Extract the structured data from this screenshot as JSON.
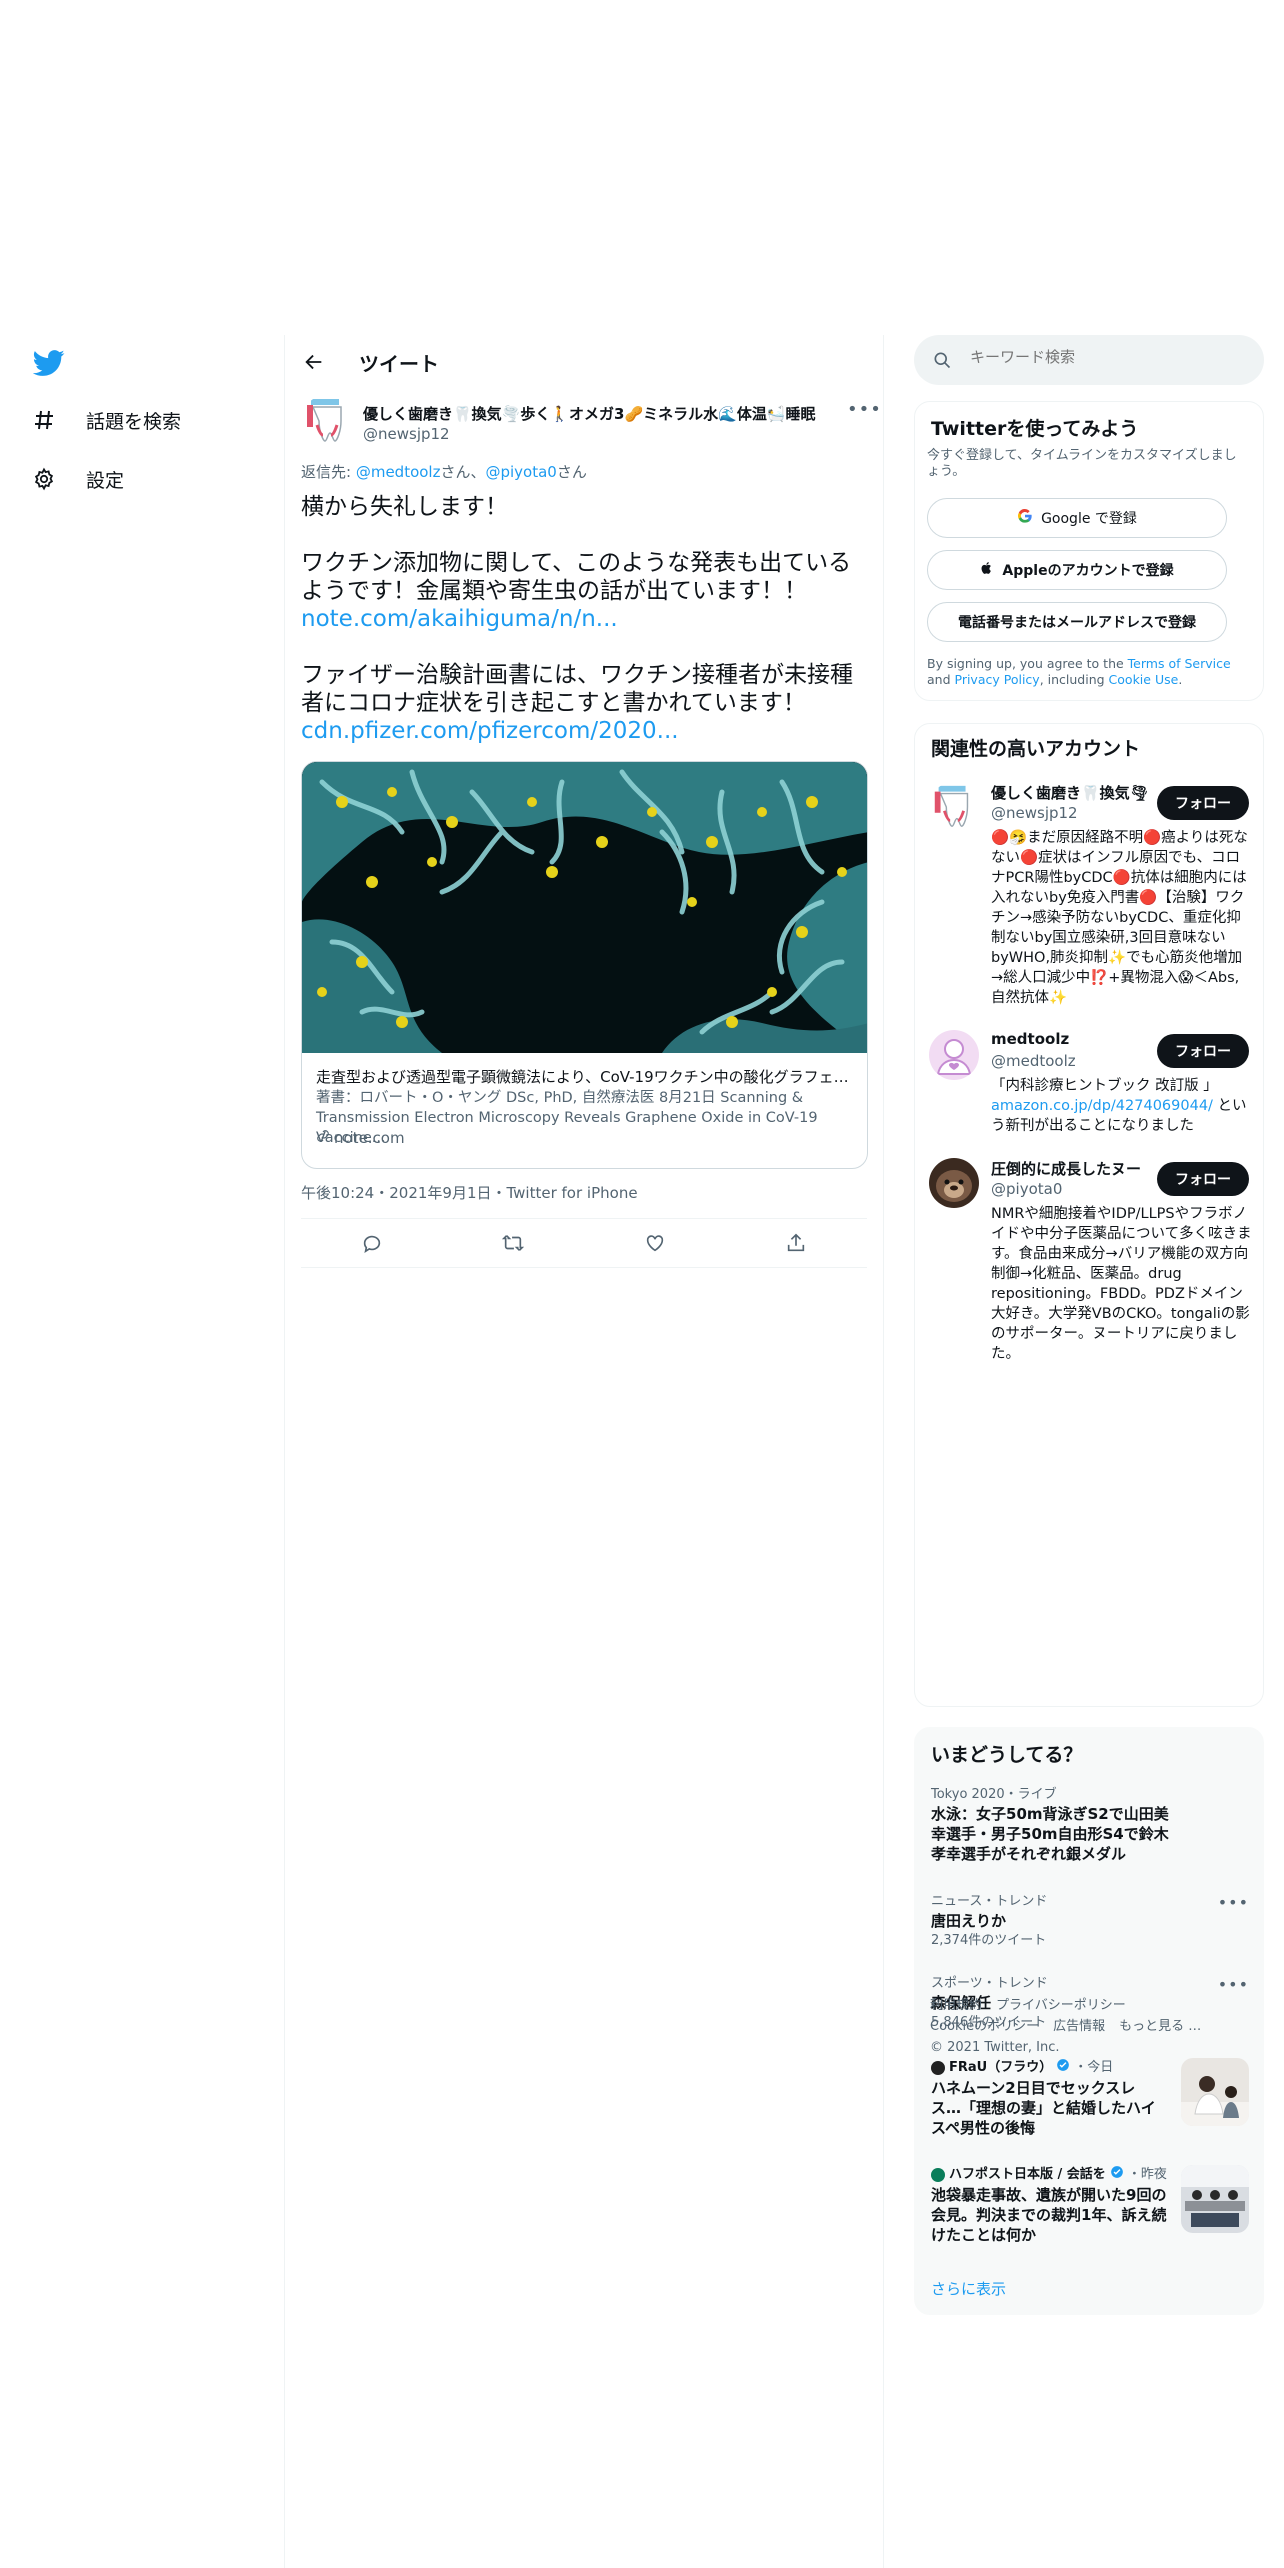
{
  "nav": {
    "items": [
      {
        "label": "話題を検索",
        "icon": "hashtag-icon"
      },
      {
        "label": "設定",
        "icon": "gear-icon"
      }
    ]
  },
  "header": {
    "title": "ツイート"
  },
  "tweet": {
    "author_name": "優しく歯磨き🦷換気🌪️歩く🚶オメガ3🥜ミネラル水🌊体温🛀睡眠",
    "author_handle": "@newsjp12",
    "reply_prefix": "返信先: ",
    "reply_to_1": "@medtoolz",
    "reply_sep": "さん、",
    "reply_to_2": "@piyota0",
    "reply_suffix": "さん",
    "line1": "横から失礼します！",
    "line2": "ワクチン添加物に関して、このような発表も出ているようです！金属類や寄生虫の話が出ています！！",
    "link1": "note.com/akaihiguma/n/n...",
    "line3": "ファイザー治験計画書には、ワクチン接種者が未接種者にコロナ症状を引き起こすと書かれています！",
    "link2": "cdn.pfizer.com/pfizercom/2020...",
    "card": {
      "title": "走査型および透過型電子顕微鏡法により、CoV-19ワクチン中の酸化グラフェンが明らかに",
      "description": "著書：ロバート・O・ヤング DSc, PhD, 自然療法医 8月21日 Scanning & Transmission Electron Microscopy Reveals Graphene Oxide in CoV-19 Vaccine...",
      "domain": "note.com"
    },
    "timestamp": "午後10:24・2021年9月1日・Twitter for iPhone"
  },
  "search": {
    "placeholder": "キーワード検索"
  },
  "signup": {
    "title": "Twitterを使ってみよう",
    "subtitle": "今すぐ登録して、タイムラインをカスタマイズしましょう。",
    "google": "Google で登録",
    "apple": "Appleのアカウントで登録",
    "phone": "電話番号またはメールアドレスで登録",
    "terms_prefix": "By signing up, you agree to the ",
    "terms_link": "Terms of Service",
    "terms_and": " and ",
    "privacy_link": "Privacy Policy",
    "terms_including": ", including ",
    "cookie_link": "Cookie Use",
    "terms_end": "."
  },
  "relevant": {
    "title": "関連性の高いアカウント",
    "follow_label": "フォロー",
    "accounts": [
      {
        "name": "優しく歯磨き🦷換気🌪",
        "handle": "@newsjp12",
        "bio": "🔴🤧まだ原因経路不明🔴癌よりは死なない🔴症状はインフル原因でも、コロナPCR陽性byCDC🔴抗体は細胞内には入れないby免疫入門書🔴【治験】ワクチン→感染予防ないbyCDC、重症化抑制ないby国立感染研,3回目意味ないbyWHO,肺炎抑制✨でも心筋炎他増加→総人口減少中⁉️+異物混入😱＜Abs,自然抗体✨"
      },
      {
        "name": "medtoolz",
        "handle": "@medtoolz",
        "bio_text": "「内科診療ヒントブック 改訂版 」",
        "bio_link": "amazon.co.jp/dp/4274069044/",
        "bio_tail": " という新刊が出ることになりました"
      },
      {
        "name": "圧倒的に成長したヌー",
        "handle": "@piyota0",
        "bio": "NMRや細胞接着やIDP/LLPSやフラボノイドや中分子医薬品について多く呟きます。食品由来成分→バリア機能の双方向制御→化粧品、医薬品。drug repositioning。FBDD。PDZドメイン大好き。大学発VBのCKO。tongaliの影のサポーター。ヌートリアに戻りました。"
      }
    ]
  },
  "trends": {
    "title": "いまどうしてる？",
    "items": [
      {
        "context": "Tokyo 2020・ライブ",
        "title": "水泳：女子50m背泳ぎS2で山田美幸選手・男子50m自由形S4で鈴木孝幸選手がそれぞれ銀メダル"
      },
      {
        "context": "ニュース・トレンド",
        "title": "唐田えりか",
        "count": "2,374件のツイート"
      },
      {
        "context": "スポーツ・トレンド",
        "title": "森保解任",
        "count": "5,846件のツイート"
      },
      {
        "source": "FRaU（フラウ）",
        "time": "・今日",
        "title": "ハネムーン2日目でセックスレス…「理想の妻」と結婚したハイスペ男性の後悔"
      },
      {
        "source": "ハフポスト日本版 / 会話を",
        "time": "・昨夜",
        "title": "池袋暴走事故、遺族が開いた9回の会見。判決までの裁判1年、訴え続けたことは何か"
      }
    ],
    "show_more": "さらに表示"
  },
  "footer": {
    "terms": "利用規約",
    "privacy": "プライバシーポリシー",
    "cookie": "Cookieのポリシー",
    "ads": "広告情報",
    "more": "もっと見る …",
    "copyright": "© 2021 Twitter, Inc."
  },
  "colors": {
    "brand": "#1d9bf0",
    "text": "#0f1419",
    "muted": "#536471",
    "verified": "#1d9bf0"
  }
}
